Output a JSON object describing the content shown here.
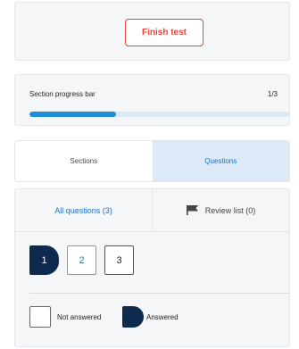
{
  "finish": {
    "label": "Finish test",
    "color": "#e5483c"
  },
  "progress": {
    "label": "Section progress bar",
    "count": "1/3",
    "fraction": 0.333
  },
  "tabs": [
    {
      "label": "Sections",
      "active": false
    },
    {
      "label": "Questions",
      "active": true
    }
  ],
  "subtabs": {
    "all": "All questions (3)",
    "review": "Review list (0)",
    "review_icon": "flag-icon"
  },
  "questions": [
    {
      "number": "1",
      "state": "answered"
    },
    {
      "number": "2",
      "state": "current"
    },
    {
      "number": "3",
      "state": "not-answered"
    }
  ],
  "legend": {
    "not_answered": "Not answered",
    "answered": "Answered"
  },
  "colors": {
    "accent": "#1e8fd6",
    "answered": "#0e2a4e",
    "active_tab_bg": "#dce9f7"
  }
}
